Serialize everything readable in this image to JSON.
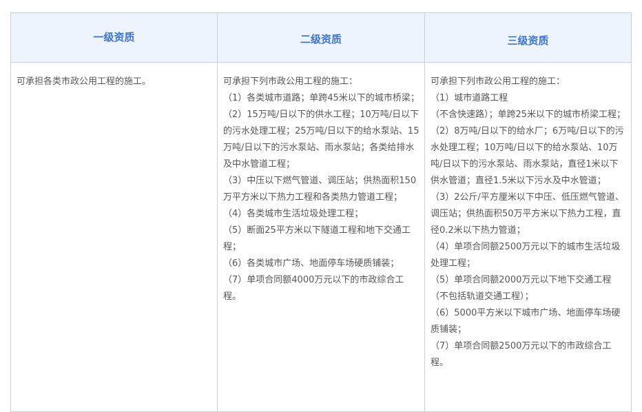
{
  "headers": {
    "level1": "一级资质",
    "level2": "二级资质",
    "level3": "三级资质"
  },
  "level1": {
    "intro": "可承担各类市政公用工程的施工。"
  },
  "level2": {
    "intro": "可承担下列市政公用工程的施工：",
    "items": [
      "（1）各类城市道路；单跨45米以下的城市桥梁；",
      "（2）15万吨/日以下的供水工程；10万吨/日以下的污水处理工程；25万吨/日以下的给水泵站、15万吨/日以下的污水泵站、雨水泵站；各类给排水及中水管道工程；",
      "（3）中压以下燃气管道、调压站；供热面积150万平方米以下热力工程和各类热力管道工程；",
      "（4）各类城市生活垃圾处理工程；",
      "（5）断面25平方米以下隧道工程和地下交通工程；",
      "（6）各类城市广场、地面停车场硬质铺装；",
      "（7）单项合同额4000万元以下的市政综合工程。"
    ]
  },
  "level3": {
    "intro": "可承担下列市政公用工程的施工：",
    "items": [
      "（1）城市道路工程",
      "（不含快速路）；单跨25米以下的城市桥梁工程；",
      "（2）8万吨/日以下的给水厂；6万吨/日以下的污水处理工程；10万吨/日以下的给水泵站、10万吨/日以下的污水泵站、雨水泵站，直径1米以下供水管道；直径1.5米以下污水及中水管道；",
      "（3）2公斤/平方厘米以下中压、低压燃气管道、调压站；供热面积50万平方米以下热力工程，直径0.2米以下热力管道；",
      "（4）单项合同额2500万元以下的城市生活垃圾处理工程；",
      "（5）单项合同额2000万元以下地下交通工程（不包括轨道交通工程）；",
      "（6）5000平方米以下城市广场、地面停车场硬质铺装；",
      "（7）单项合同额2500万元以下的市政综合工程。"
    ]
  }
}
